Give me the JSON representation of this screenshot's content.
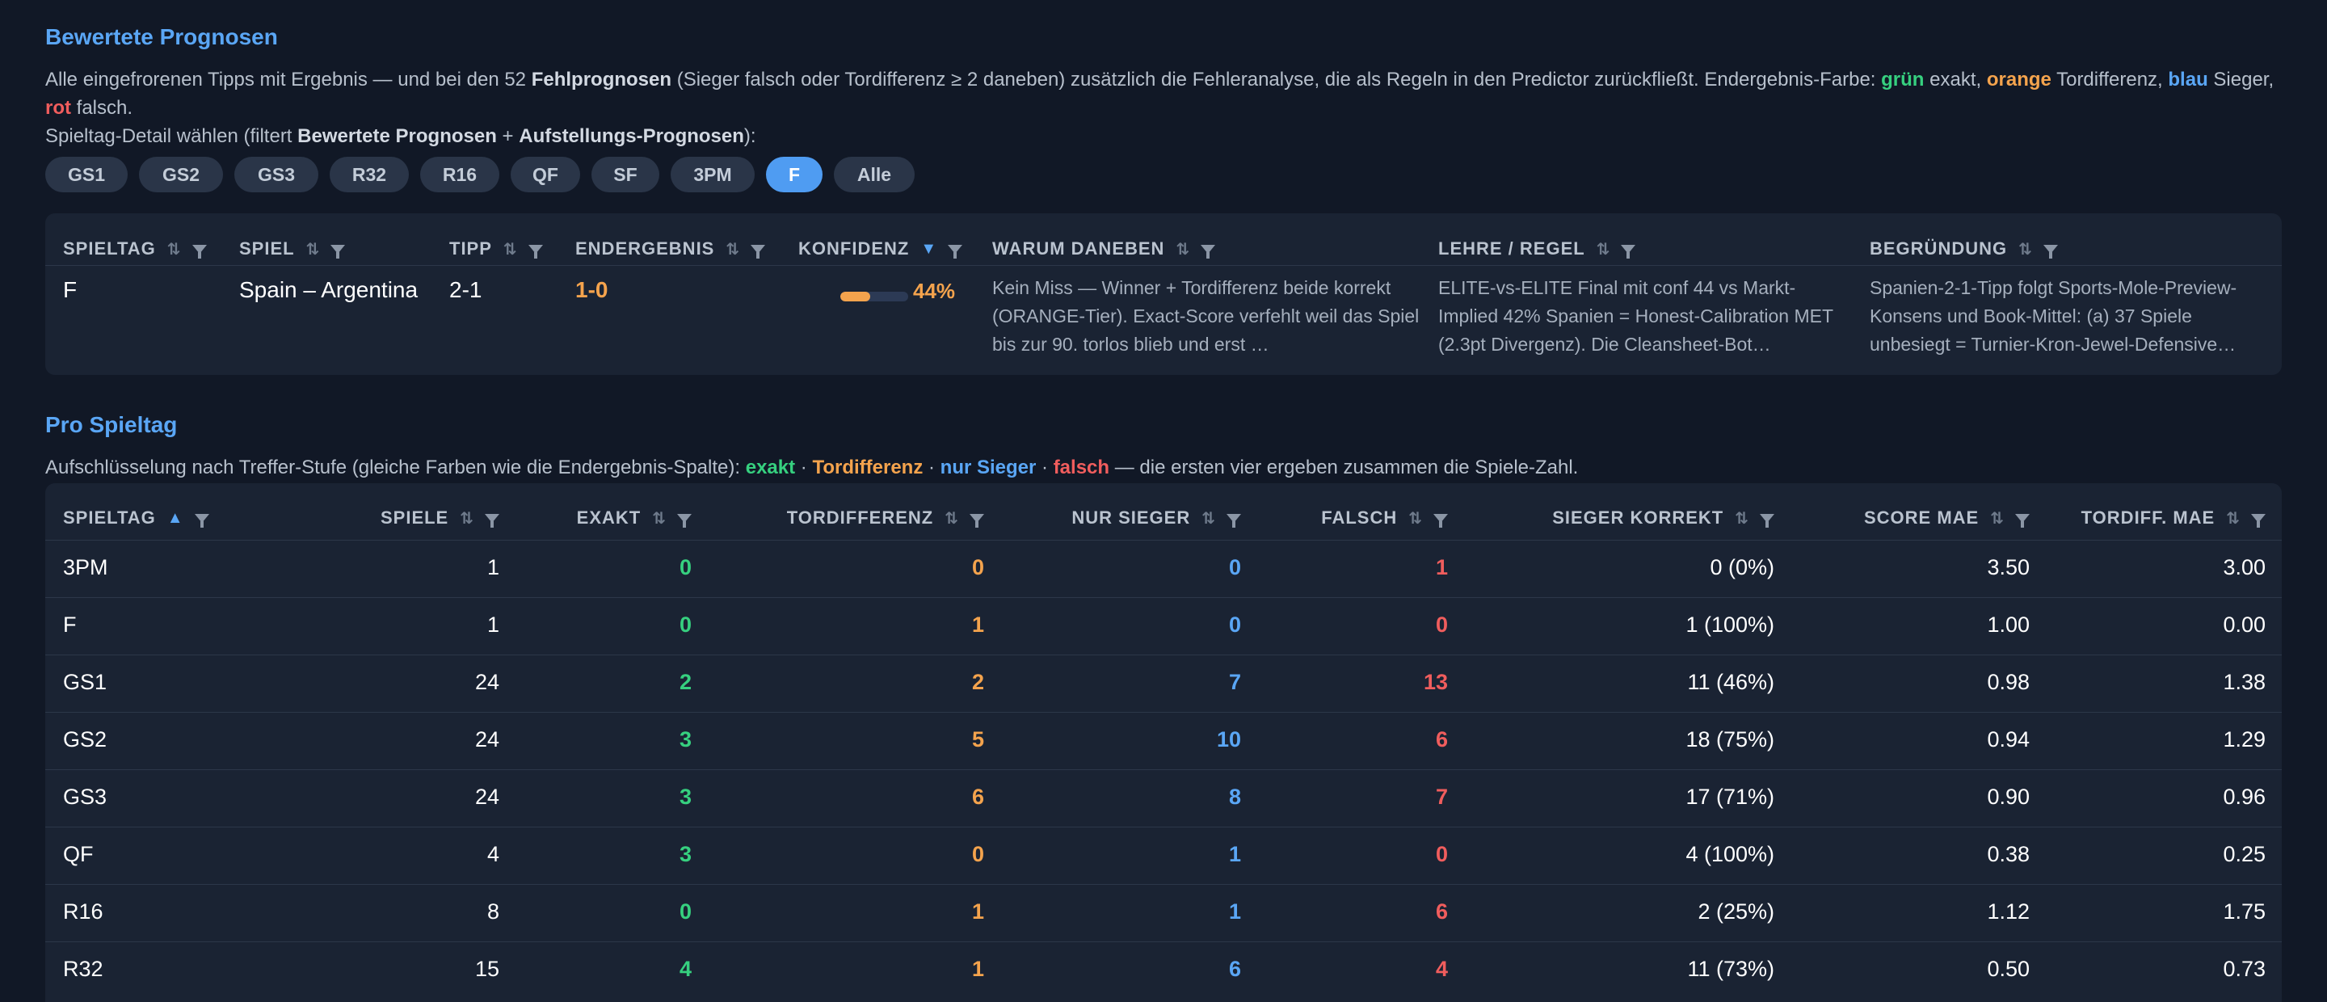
{
  "section1": {
    "title": "Bewertete Prognosen",
    "intro_a": "Alle eingefrorenen Tipps mit Ergebnis — und bei den 52 ",
    "intro_b": "Fehlprognosen",
    "intro_c": " (Sieger falsch oder Tordifferenz ≥ 2 daneben) zusätzlich die Fehleranalyse, die als Regeln in den Predictor zurückfließt. Endergebnis-Farbe: ",
    "green_word": "grün",
    "green_desc": " exakt, ",
    "orange_word": "orange",
    "orange_desc": " Tordifferenz, ",
    "blue_word": "blau",
    "blue_desc": " Sieger,",
    "red_word": "rot",
    "red_desc": " falsch.",
    "filter_a": "Spieltag-Detail wählen (filtert ",
    "filter_b": "Bewertete Prognosen",
    "filter_c": " + ",
    "filter_d": "Aufstellungs-Prognosen",
    "filter_e": "):",
    "chips": [
      "GS1",
      "GS2",
      "GS3",
      "R32",
      "R16",
      "QF",
      "SF",
      "3PM",
      "F",
      "Alle"
    ],
    "active_chip": "F",
    "headers": {
      "spieltag": "SPIELTAG",
      "spiel": "SPIEL",
      "tipp": "TIPP",
      "endergebnis": "ENDERGEBNIS",
      "konfidenz": "KONFIDENZ",
      "warum": "WARUM DANEBEN",
      "lehre": "LEHRE / REGEL",
      "begruendung": "BEGRÜNDUNG"
    },
    "row": {
      "spieltag": "F",
      "spiel": "Spain – Argentina",
      "tipp": "2-1",
      "endergebnis": "1-0",
      "konfidenz": 0.44,
      "konfidenz_label": "44%",
      "warum": "Kein Miss — Winner + Tordifferenz beide korrekt (ORANGE-Tier). Exact-Score verfehlt weil das Spiel bis zur 90. torlos blieb und erst …",
      "lehre": "ELITE-vs-ELITE Final mit conf 44 vs Markt-Implied 42% Spanien = Honest-Calibration MET (2.3pt Divergenz). Die Cleansheet-Bot…",
      "begruendung": "Spanien-2-1-Tipp folgt Sports-Mole-Preview-Konsens und Book-Mittel: (a) 37 Spiele unbesiegt = Turnier-Kron-Jewel-Defensive…"
    },
    "colors": {
      "accent": "#5aa6f5",
      "green": "#36d07f",
      "orange": "#f4a34d",
      "red": "#f05d5d"
    }
  },
  "section2": {
    "title": "Pro Spieltag",
    "intro_a": "Aufschlüsselung nach Treffer-Stufe (gleiche Farben wie die Endergebnis-Spalte): ",
    "exakt": "exakt",
    "sep": " · ",
    "tordiff": "Tordifferenz",
    "nur_sieger": "nur Sieger",
    "falsch": "falsch",
    "intro_end": " — die ersten vier ergeben zusammen die Spiele-Zahl.",
    "headers": {
      "spieltag": "SPIELTAG",
      "spiele": "SPIELE",
      "exakt": "EXAKT",
      "tordifferenz": "TORDIFFERENZ",
      "nur_sieger": "NUR SIEGER",
      "falsch": "FALSCH",
      "sieger_korrekt": "SIEGER KORREKT",
      "score_mae": "SCORE MAE",
      "tordiff_mae": "TORDIFF. MAE"
    },
    "rows": [
      {
        "spieltag": "3PM",
        "spiele": "1",
        "exakt": "0",
        "tordiff": "0",
        "sieger": "0",
        "falsch": "1",
        "korrekt": "0 (0%)",
        "score_mae": "3.50",
        "tordiff_mae": "3.00"
      },
      {
        "spieltag": "F",
        "spiele": "1",
        "exakt": "0",
        "tordiff": "1",
        "sieger": "0",
        "falsch": "0",
        "korrekt": "1 (100%)",
        "score_mae": "1.00",
        "tordiff_mae": "0.00"
      },
      {
        "spieltag": "GS1",
        "spiele": "24",
        "exakt": "2",
        "tordiff": "2",
        "sieger": "7",
        "falsch": "13",
        "korrekt": "11 (46%)",
        "score_mae": "0.98",
        "tordiff_mae": "1.38"
      },
      {
        "spieltag": "GS2",
        "spiele": "24",
        "exakt": "3",
        "tordiff": "5",
        "sieger": "10",
        "falsch": "6",
        "korrekt": "18 (75%)",
        "score_mae": "0.94",
        "tordiff_mae": "1.29"
      },
      {
        "spieltag": "GS3",
        "spiele": "24",
        "exakt": "3",
        "tordiff": "6",
        "sieger": "8",
        "falsch": "7",
        "korrekt": "17 (71%)",
        "score_mae": "0.90",
        "tordiff_mae": "0.96"
      },
      {
        "spieltag": "QF",
        "spiele": "4",
        "exakt": "3",
        "tordiff": "0",
        "sieger": "1",
        "falsch": "0",
        "korrekt": "4 (100%)",
        "score_mae": "0.38",
        "tordiff_mae": "0.25"
      },
      {
        "spieltag": "R16",
        "spiele": "8",
        "exakt": "0",
        "tordiff": "1",
        "sieger": "1",
        "falsch": "6",
        "korrekt": "2 (25%)",
        "score_mae": "1.12",
        "tordiff_mae": "1.75"
      },
      {
        "spieltag": "R32",
        "spiele": "15",
        "exakt": "4",
        "tordiff": "1",
        "sieger": "6",
        "falsch": "4",
        "korrekt": "11 (73%)",
        "score_mae": "0.50",
        "tordiff_mae": "0.73"
      }
    ]
  }
}
